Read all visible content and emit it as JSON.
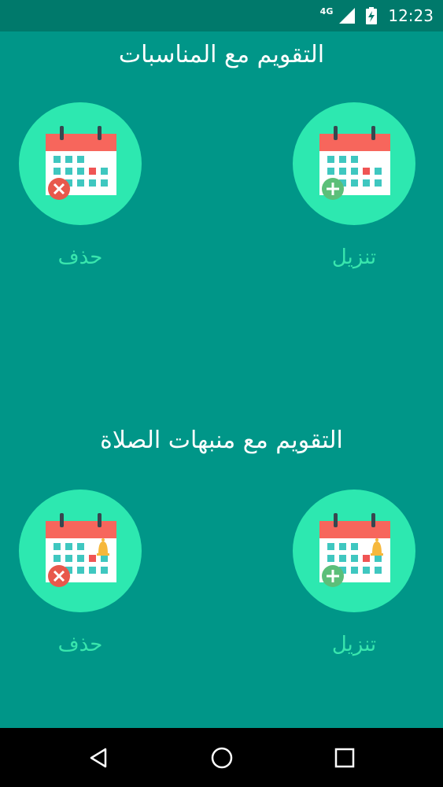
{
  "status_bar": {
    "network": "4G",
    "time": "12:23",
    "icons": [
      "signal-icon",
      "battery-charging-icon"
    ]
  },
  "section_events": {
    "title": "التقويم مع المناسبات",
    "download_label": "تنزيل",
    "delete_label": "حذف",
    "icons": [
      "calendar-add-icon",
      "calendar-delete-icon"
    ]
  },
  "section_prayer": {
    "title": "التقويم مع منبهات الصلاة",
    "download_label": "تنزيل",
    "delete_label": "حذف",
    "icons": [
      "calendar-alarm-add-icon",
      "calendar-alarm-delete-icon"
    ]
  },
  "nav_bar": {
    "icons": [
      "back-icon",
      "home-icon",
      "recents-icon"
    ]
  },
  "colors": {
    "background": "#009688",
    "status_bar": "#00796b",
    "circle": "#2de8b0",
    "label": "#39e6ad",
    "calendar_header": "#f7665c",
    "cell": "#3fc7c0",
    "highlight_cell": "#f05454",
    "delete_badge": "#e8584c",
    "add_badge": "#5cbf79",
    "bell": "#f6b83c"
  }
}
